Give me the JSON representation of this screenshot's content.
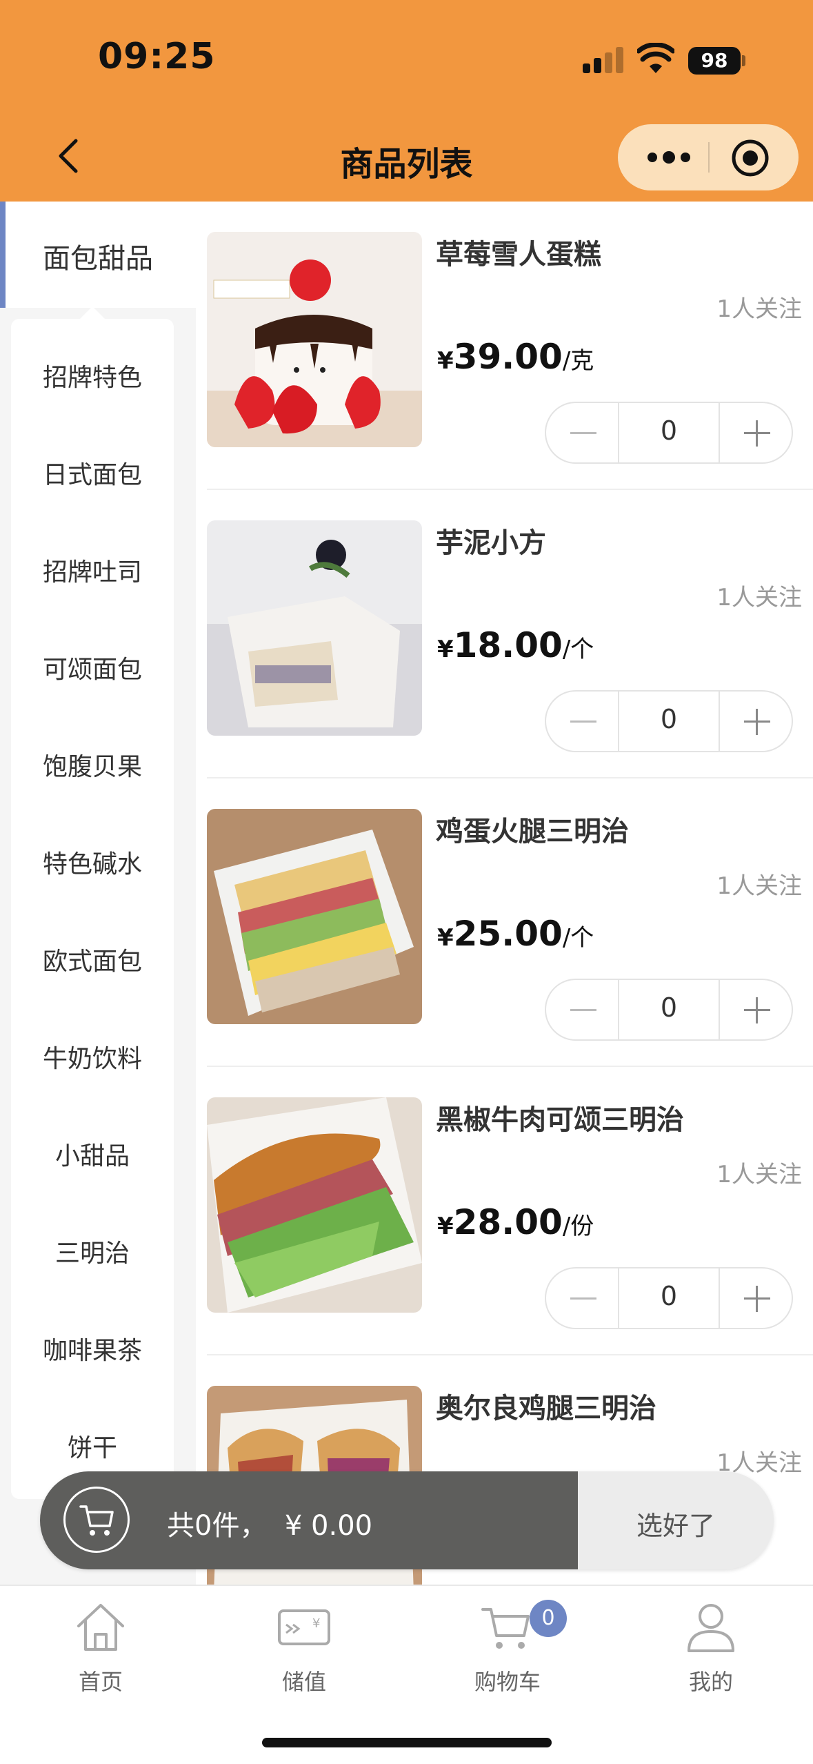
{
  "status_bar": {
    "time": "09:25",
    "battery": "98"
  },
  "header": {
    "title": "商品列表"
  },
  "categories": {
    "active": "面包甜品",
    "items": [
      "招牌特色",
      "日式面包",
      "招牌吐司",
      "可颂面包",
      "饱腹贝果",
      "特色碱水",
      "欧式面包",
      "牛奶饮料",
      "小甜品",
      "三明治",
      "咖啡果茶",
      "饼干"
    ]
  },
  "products": [
    {
      "name": "草莓雪人蛋糕",
      "follow": "1人关注",
      "currency": "¥",
      "price": "39.00",
      "unit": "/克",
      "qty": "0",
      "image_icon": "strawberry-cake-photo"
    },
    {
      "name": "芋泥小方",
      "follow": "1人关注",
      "currency": "¥",
      "price": "18.00",
      "unit": "/个",
      "qty": "0",
      "image_icon": "taro-cake-photo"
    },
    {
      "name": "鸡蛋火腿三明治",
      "follow": "1人关注",
      "currency": "¥",
      "price": "25.00",
      "unit": "/个",
      "qty": "0",
      "image_icon": "egg-ham-sandwich-photo"
    },
    {
      "name": "黑椒牛肉可颂三明治",
      "follow": "1人关注",
      "currency": "¥",
      "price": "28.00",
      "unit": "/份",
      "qty": "0",
      "image_icon": "croissant-sandwich-photo"
    },
    {
      "name": "奥尔良鸡腿三明治",
      "follow": "1人关注",
      "currency": "¥",
      "price": "",
      "unit": "",
      "qty": "",
      "image_icon": "chicken-sandwich-photo"
    }
  ],
  "cart": {
    "summary": "共0件，  ¥ 0.00",
    "done_label": "选好了"
  },
  "tabbar": {
    "items": [
      {
        "label": "首页",
        "icon": "home-icon"
      },
      {
        "label": "储值",
        "icon": "wallet-card-icon"
      },
      {
        "label": "购物车",
        "icon": "cart-icon",
        "badge": "0"
      },
      {
        "label": "我的",
        "icon": "user-icon"
      }
    ]
  },
  "colors": {
    "header": "#F2973F",
    "accent": "#6E86C4",
    "capsule": "#FBE0BB",
    "cart_dark": "#5E5E5C"
  }
}
